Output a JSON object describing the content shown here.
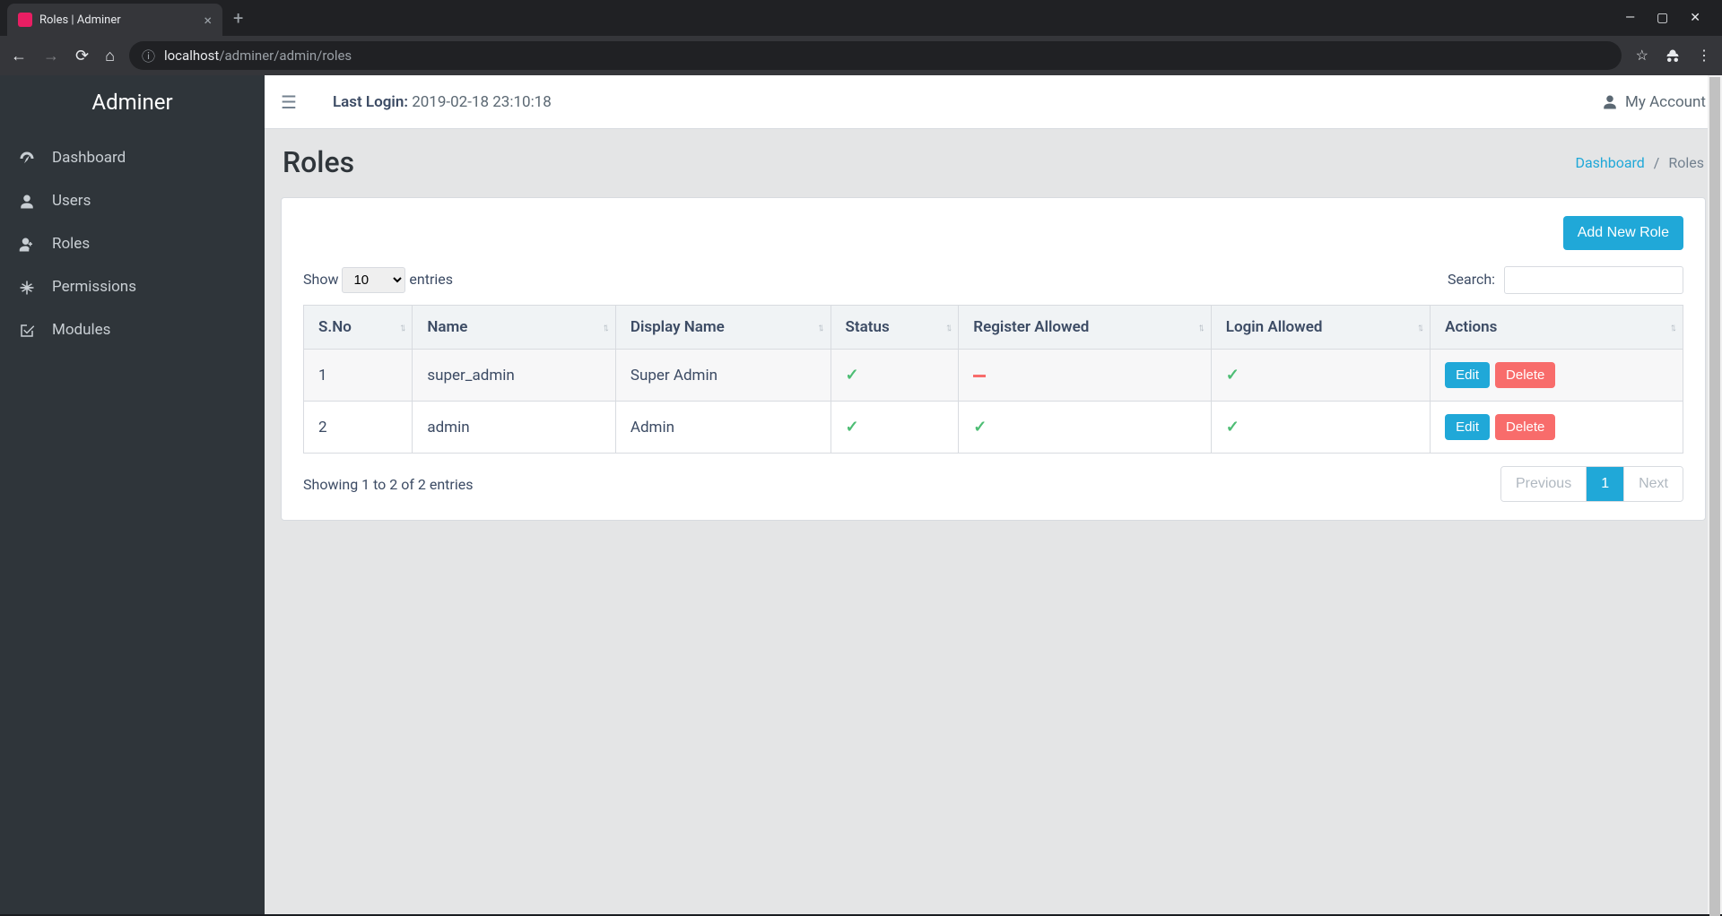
{
  "browser": {
    "tab_title": "Roles | Adminer",
    "url_host": "localhost",
    "url_path": "/adminer/admin/roles"
  },
  "sidebar": {
    "brand": "Adminer",
    "items": [
      {
        "label": "Dashboard"
      },
      {
        "label": "Users"
      },
      {
        "label": "Roles"
      },
      {
        "label": "Permissions"
      },
      {
        "label": "Modules"
      }
    ]
  },
  "topbar": {
    "last_login_label": "Last Login:",
    "last_login_value": "2019-02-18 23:10:18",
    "my_account": "My Account"
  },
  "page": {
    "title": "Roles",
    "breadcrumb_dashboard": "Dashboard",
    "breadcrumb_current": "Roles"
  },
  "table": {
    "add_button": "Add New Role",
    "show_label": "Show",
    "entries_label": "entries",
    "length_value": "10",
    "search_label": "Search:",
    "columns": {
      "sno": "S.No",
      "name": "Name",
      "display_name": "Display Name",
      "status": "Status",
      "register_allowed": "Register Allowed",
      "login_allowed": "Login Allowed",
      "actions": "Actions"
    },
    "rows": [
      {
        "sno": "1",
        "name": "super_admin",
        "display_name": "Super Admin",
        "status": true,
        "register_allowed": false,
        "login_allowed": true
      },
      {
        "sno": "2",
        "name": "admin",
        "display_name": "Admin",
        "status": true,
        "register_allowed": true,
        "login_allowed": true
      }
    ],
    "edit_label": "Edit",
    "delete_label": "Delete",
    "info": "Showing 1 to 2 of 2 entries",
    "pagination": {
      "previous": "Previous",
      "page": "1",
      "next": "Next"
    }
  }
}
